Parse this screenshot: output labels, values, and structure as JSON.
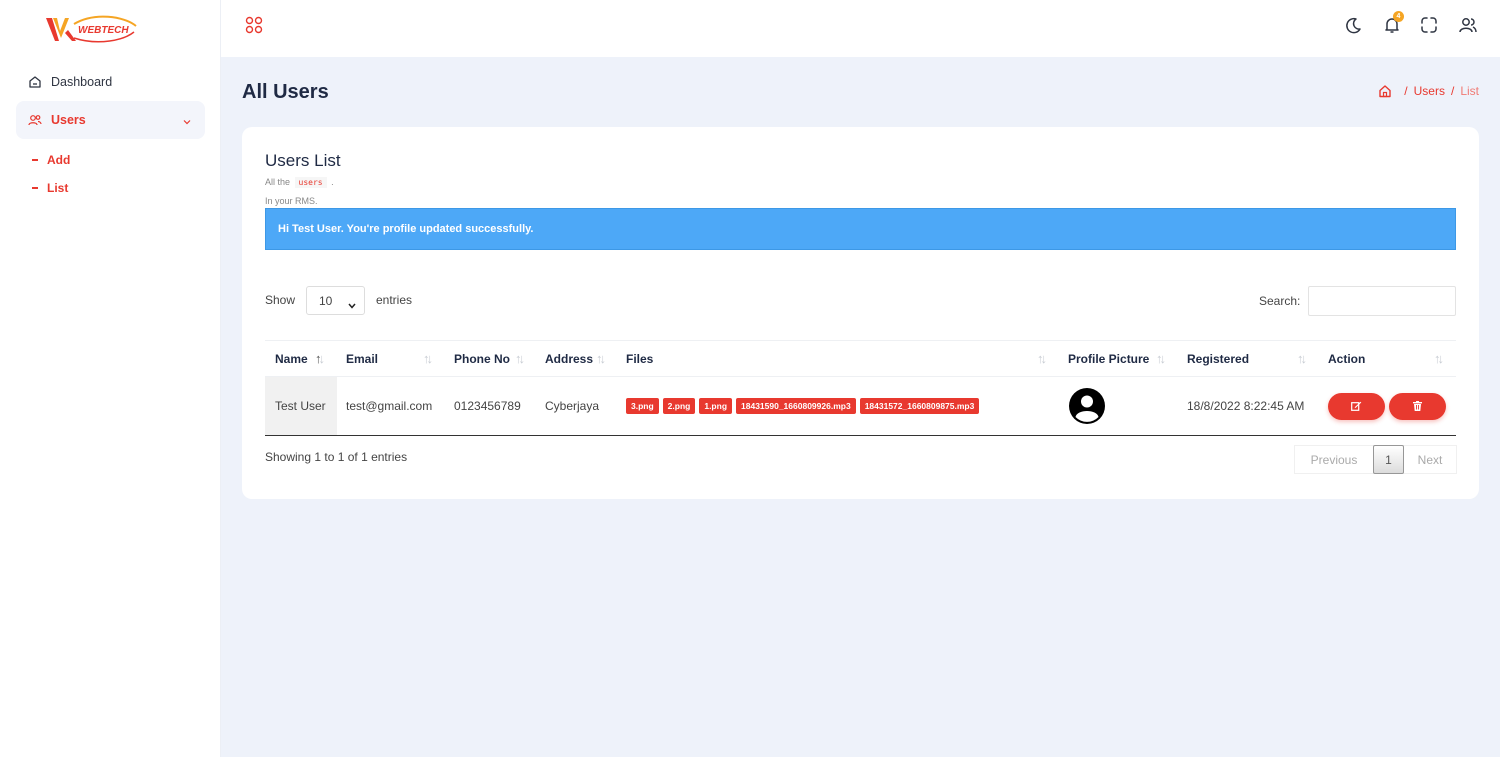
{
  "brand": {
    "logo_text": "WEBTECH"
  },
  "sidebar": {
    "dashboard": "Dashboard",
    "users": "Users",
    "sub": {
      "add": "Add",
      "list": "List"
    }
  },
  "header": {
    "notifications_count": "4",
    "icons": [
      "apps-icon",
      "moon-icon",
      "bell-icon",
      "expand-icon",
      "user-icon"
    ]
  },
  "page": {
    "title": "All Users",
    "breadcrumb": {
      "users": "Users",
      "list": "List",
      "sep": "/"
    }
  },
  "card": {
    "title": "Users List",
    "sub1_pre": "All the",
    "sub1_code": "users",
    "sub1_post": ".",
    "sub2": "In your RMS.",
    "alert": "Hi Test User. You're profile updated successfully."
  },
  "controls": {
    "show": "Show",
    "entries_value": "10",
    "entries": "entries",
    "search_label": "Search:",
    "search_value": ""
  },
  "table": {
    "columns": [
      "Name",
      "Email",
      "Phone No",
      "Address",
      "Files",
      "Profile Picture",
      "Registered",
      "Action"
    ],
    "rows": [
      {
        "name": "Test User",
        "email": "test@gmail.com",
        "phone": "0123456789",
        "address": "Cyberjaya",
        "files": [
          "3.png",
          "2.png",
          "1.png",
          "18431590_1660809926.mp3",
          "18431572_1660809875.mp3"
        ],
        "registered": "18/8/2022 8:22:45 AM"
      }
    ]
  },
  "footer": {
    "info": "Showing 1 to 1 of 1 entries",
    "prev": "Previous",
    "page": "1",
    "next": "Next"
  },
  "colors": {
    "accent": "#e8392f",
    "alert": "#4da8f7",
    "background": "#eef2fa"
  }
}
